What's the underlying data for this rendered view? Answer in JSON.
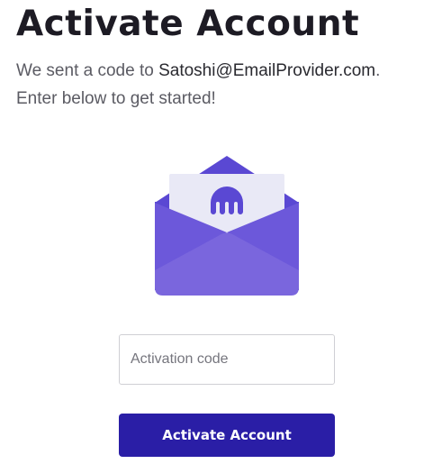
{
  "page": {
    "title": "Activate Account",
    "subtitle_prefix": "We sent a code to ",
    "email": "Satoshi@EmailProvider.com",
    "subtitle_suffix": ".",
    "subtitle_line2": "Enter below to get started!"
  },
  "illustration": {
    "icon": "envelope-icon",
    "logo_icon": "kraken-logo-icon"
  },
  "form": {
    "code_placeholder": "Activation code",
    "code_value": "",
    "submit_label": "Activate Account"
  },
  "colors": {
    "brand": "#2a1ea6",
    "envelope_front": "#7a66dd",
    "envelope_back": "#5a48d3",
    "letter": "#e9e9f6"
  }
}
